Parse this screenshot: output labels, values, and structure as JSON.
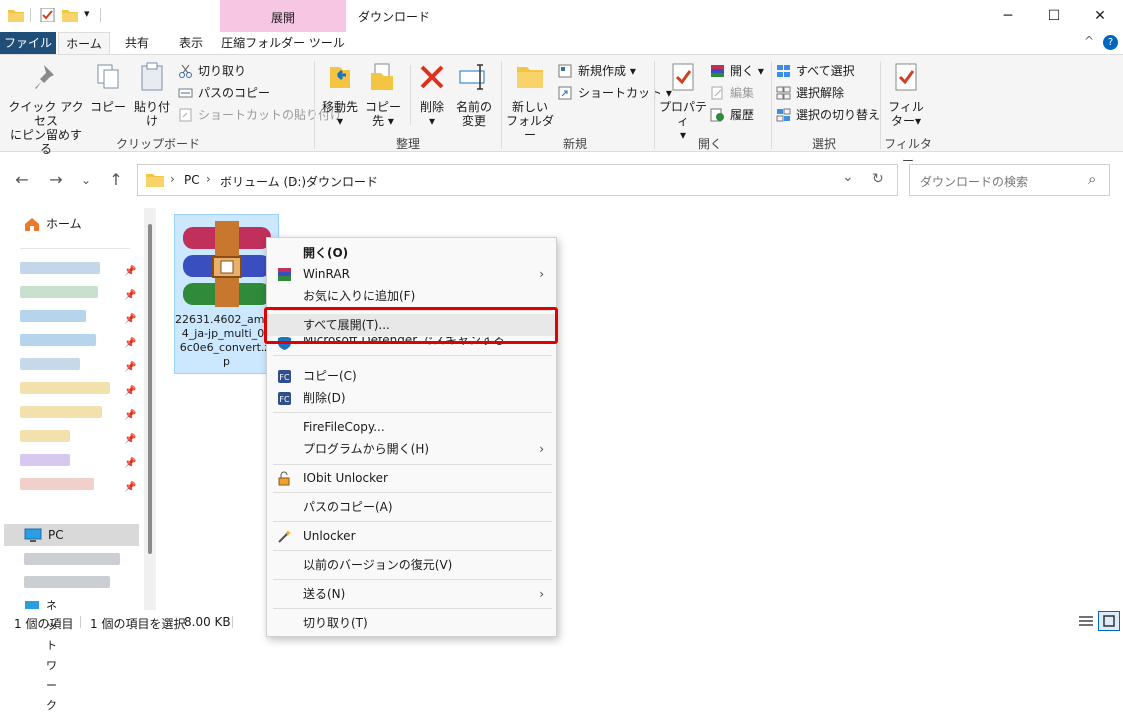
{
  "window": {
    "title": "ダウンロード",
    "context_tab_header": "展開",
    "min_glyph": "─",
    "max_glyph": "☐",
    "close_glyph": "✕"
  },
  "ribbon_tabs": {
    "file": "ファイル",
    "home": "ホーム",
    "share": "共有",
    "view": "表示",
    "compressed_tools": "圧縮フォルダー ツール",
    "collapse_glyph": "^",
    "help_glyph": "?"
  },
  "ribbon": {
    "clipboard": {
      "label": "クリップボード",
      "pin_quick_access": [
        "クイック アクセス",
        "にピン留めする"
      ],
      "copy": "コピー",
      "paste": "貼り付け",
      "cut": "切り取り",
      "copy_path": "パスのコピー",
      "paste_shortcut": "ショートカットの貼り付け"
    },
    "organize": {
      "label": "整理",
      "move_to": "移動先",
      "copy_to": "コピー先",
      "delete": "削除",
      "rename": [
        "名前の",
        "変更"
      ]
    },
    "new": {
      "label": "新規",
      "new_folder": [
        "新しい",
        "フォルダー"
      ],
      "new_item": "新規作成",
      "shortcut": "ショートカット"
    },
    "open": {
      "label": "開く",
      "properties": "プロパティ",
      "open": "開く",
      "edit": "編集",
      "history": "履歴"
    },
    "select": {
      "label": "選択",
      "select_all": "すべて選択",
      "select_none": "選択解除",
      "invert": "選択の切り替え"
    },
    "filter": {
      "label": "フィルター",
      "filter_btn": [
        "フィル",
        "ター"
      ]
    }
  },
  "address": {
    "path": [
      "PC",
      "ボリューム (D:)",
      "ダウンロード"
    ],
    "separator": "›",
    "dropdown_glyph": "⌄",
    "refresh_glyph": "↻",
    "back_glyph": "←",
    "forward_glyph": "→",
    "recent_glyph": "⌄",
    "up_glyph": "↑"
  },
  "search": {
    "placeholder": "ダウンロードの検索",
    "icon_glyph": "⌕"
  },
  "nav": {
    "home": "ホーム",
    "pc": "PC",
    "network": "ネットワーク"
  },
  "file": {
    "name_lines": [
      "22631.4602_amd6",
      "4_ja-jp_multi_0d",
      "6c0e6_convert.zi",
      "p"
    ]
  },
  "context_menu": {
    "items": [
      {
        "label": "開く(O)",
        "bold": true
      },
      {
        "label": "WinRAR",
        "submenu": true
      },
      {
        "label": "お気に入りに追加(F)"
      },
      {
        "label": "すべて展開(T)..."
      },
      {
        "label": "Microsoft Defender でスキャンする..."
      },
      {
        "label": "コピー(C)"
      },
      {
        "label": "削除(D)"
      },
      {
        "label": "FireFileCopy..."
      },
      {
        "label": "プログラムから開く(H)",
        "submenu": true
      },
      {
        "label": "IObit Unlocker"
      },
      {
        "label": "パスのコピー(A)"
      },
      {
        "label": "Unlocker"
      },
      {
        "label": "以前のバージョンの復元(V)"
      },
      {
        "label": "送る(N)",
        "submenu": true
      },
      {
        "label": "切り取り(T)"
      }
    ],
    "submenu_glyph": "›"
  },
  "status": {
    "count": "1 個の項目",
    "selected": "1 個の項目を選択",
    "size": "8.00 KB"
  },
  "colors": {
    "accent": "#0067c0",
    "highlight_red": "#e00000",
    "context_tab": "#f7c6e3",
    "selected_tile": "#cce8ff"
  }
}
